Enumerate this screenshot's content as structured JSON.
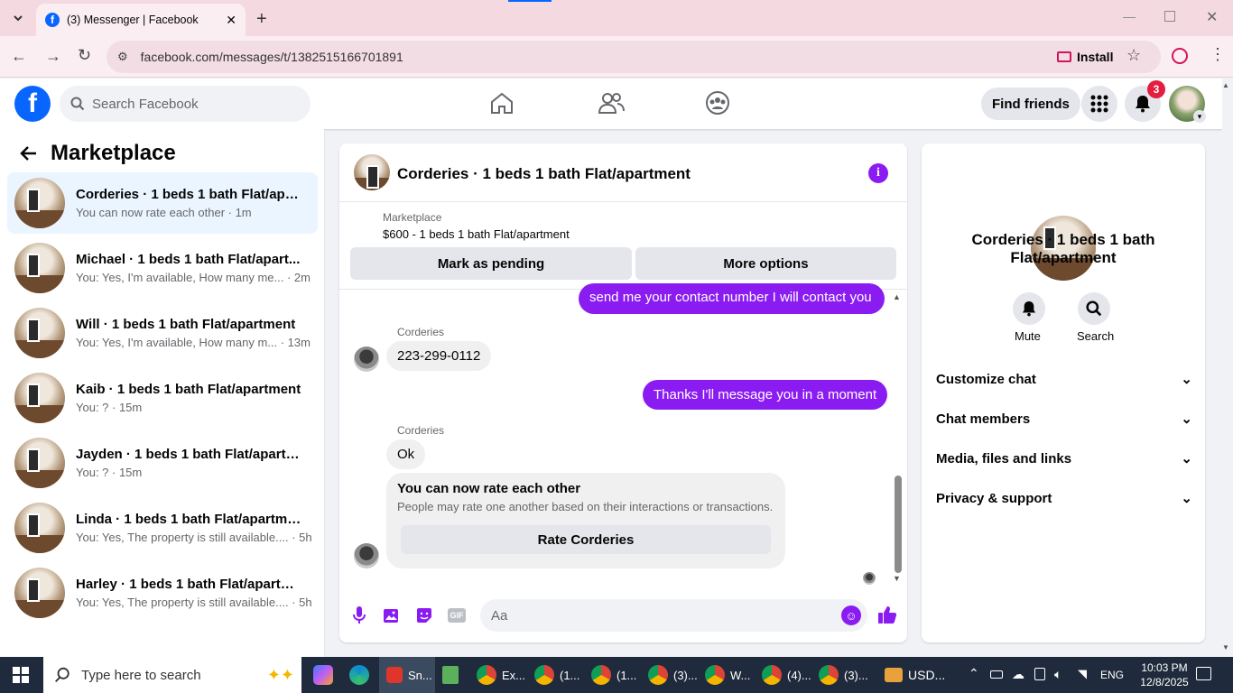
{
  "browser": {
    "tab_title": "(3) Messenger | Facebook",
    "url": "facebook.com/messages/t/1382515166701891",
    "install_label": "Install"
  },
  "fb_header": {
    "search_placeholder": "Search Facebook",
    "find_friends": "Find friends",
    "notification_count": "3"
  },
  "left": {
    "title": "Marketplace",
    "conversations": [
      {
        "title": "Corderies · 1 beds 1 bath Flat/apart...",
        "subtitle": "You can now rate each other · 1m",
        "active": true
      },
      {
        "title": "Michael · 1 beds 1 bath Flat/apart...",
        "subtitle": "You: Yes, I'm available, How many me... · 2m"
      },
      {
        "title": "Will · 1 beds 1 bath Flat/apartment",
        "subtitle": "You: Yes, I'm available, How many m... · 13m"
      },
      {
        "title": "Kaib · 1 beds 1 bath Flat/apartment",
        "subtitle": "You: ? · 15m"
      },
      {
        "title": "Jayden · 1 beds 1 bath Flat/apartm...",
        "subtitle": "You: ? · 15m"
      },
      {
        "title": "Linda · 1 beds 1 bath Flat/apartment",
        "subtitle": "You: Yes, The property is still available.... · 5h"
      },
      {
        "title": "Harley · 1 beds 1 bath Flat/apartme...",
        "subtitle": "You: Yes, The property is still available.... · 5h"
      }
    ]
  },
  "chat": {
    "title": "Corderies · 1 beds 1 bath Flat/apartment",
    "listing_source": "Marketplace",
    "listing_desc": "$600 - 1 beds 1 bath Flat/apartment",
    "mark_pending": "Mark as pending",
    "more_options": "More options",
    "messages": {
      "out1": "send me your contact number I will contact you",
      "sender1": "Corderies",
      "in1": "223-299-0112",
      "out2": "Thanks I'll message you in a moment",
      "sender2": "Corderies",
      "in2": "Ok",
      "rate_title": "You can now rate each other",
      "rate_desc": "People may rate one another based on their interactions or transactions.",
      "rate_button": "Rate Corderies"
    },
    "composer_placeholder": "Aa"
  },
  "right": {
    "name": "Corderies · 1 beds 1 bath Flat/apartment",
    "mute": "Mute",
    "search": "Search",
    "sections": [
      "Customize chat",
      "Chat members",
      "Media, files and links",
      "Privacy & support"
    ]
  },
  "taskbar": {
    "search_placeholder": "Type here to search",
    "apps": [
      {
        "label": "Sn..."
      },
      {
        "label": ""
      },
      {
        "label": "Ex..."
      },
      {
        "label": "(1..."
      },
      {
        "label": "(1..."
      },
      {
        "label": "(3)..."
      },
      {
        "label": "W..."
      },
      {
        "label": "(4)..."
      },
      {
        "label": "(3)..."
      }
    ],
    "currency": "USD...",
    "lang": "ENG",
    "time": "10:03 PM",
    "date": "12/8/2025"
  },
  "colors": {
    "accent": "#8a1cf2",
    "fb_blue": "#0866ff",
    "badge": "#e41e3f"
  }
}
